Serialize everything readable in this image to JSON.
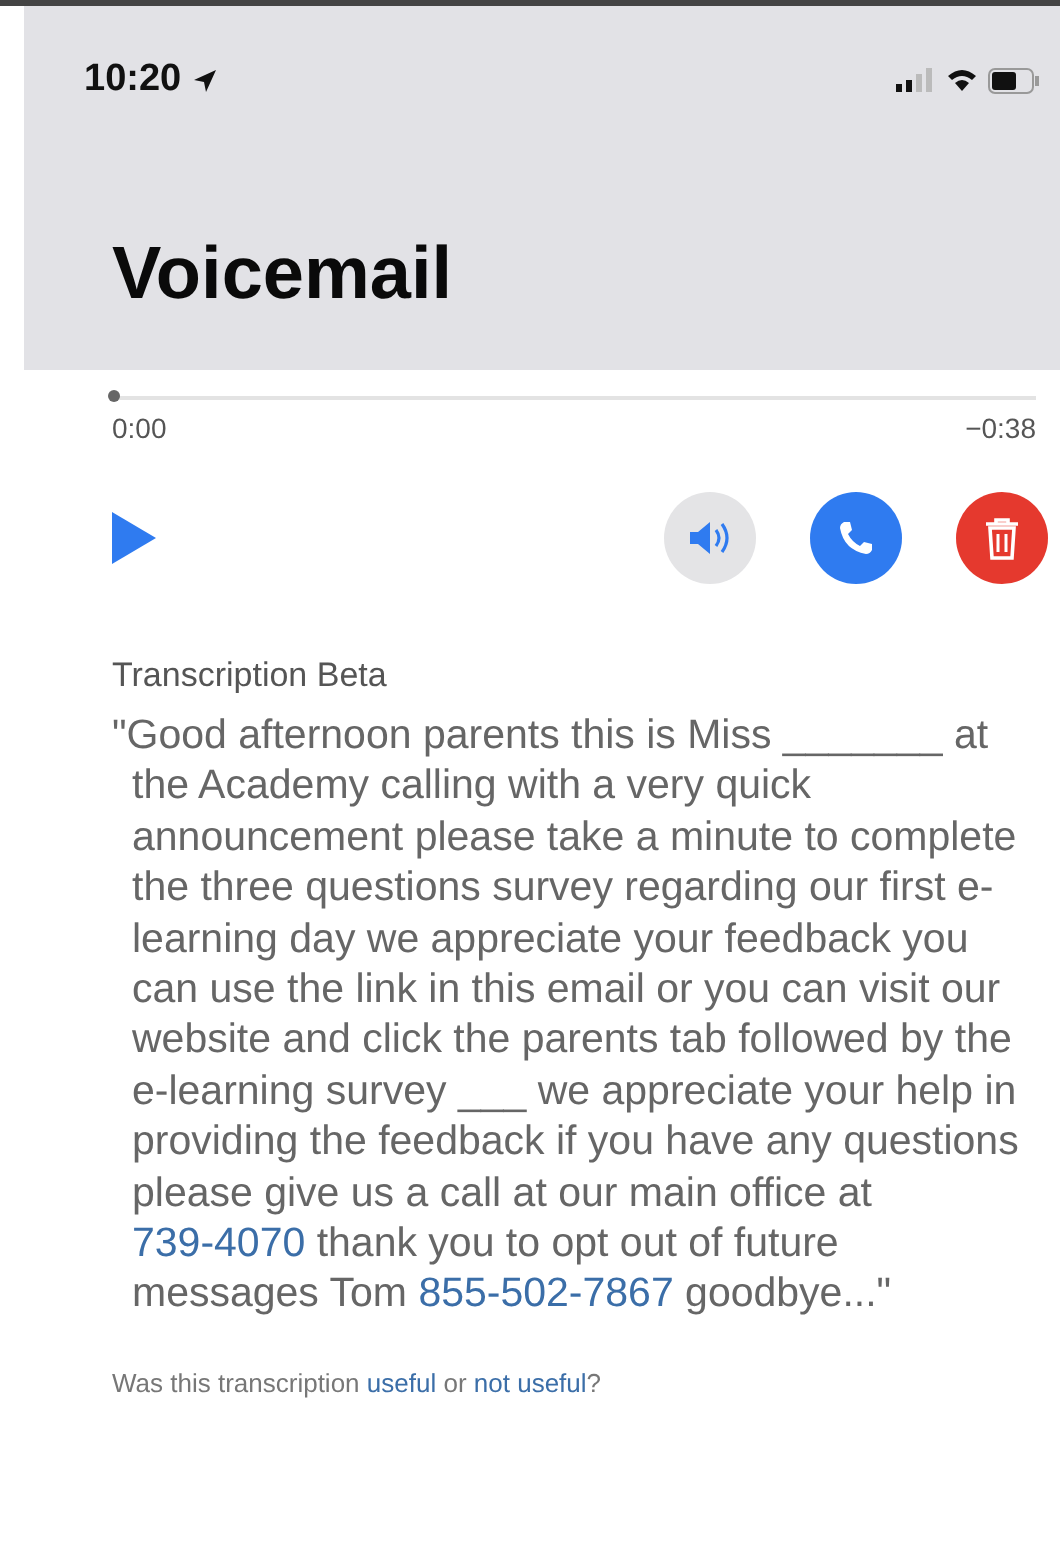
{
  "status_bar": {
    "time": "10:20"
  },
  "nav": {
    "title": "Voicemail"
  },
  "player": {
    "level": 0,
    "elapsed": "0:00",
    "remaining": "−0:38"
  },
  "transcription": {
    "heading": "Transcription Beta",
    "segments": [
      {
        "kind": "text",
        "text": "\"Good afternoon parents this is Miss _______ at the Academy calling with a very quick announcement please take a minute to complete the three questions survey regarding our first e-learning day we appreciate your feedback you can use the link in this email or you can visit our website and click the parents tab followed by the e-learning survey ___ we appreciate your help in providing the feedback if you have any questions please give us a call at our main office at "
      },
      {
        "kind": "link",
        "text": "739-4070"
      },
      {
        "kind": "text",
        "text": " thank you to opt out of future messages Tom "
      },
      {
        "kind": "link",
        "text": "855-502-7867"
      },
      {
        "kind": "text",
        "text": " goodbye...\""
      }
    ]
  },
  "feedback": [
    {
      "kind": "text",
      "text": "Was this transcription "
    },
    {
      "kind": "link",
      "text": "useful"
    },
    {
      "kind": "text",
      "text": " or "
    },
    {
      "kind": "link",
      "text": "not useful"
    },
    {
      "kind": "text",
      "text": "?"
    }
  ]
}
